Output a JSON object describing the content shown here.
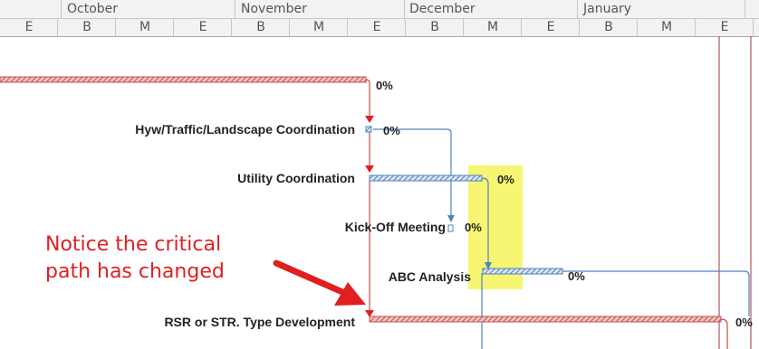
{
  "timescale": {
    "months": [
      "October",
      "November",
      "December",
      "January"
    ],
    "periods": [
      "E",
      "B",
      "M",
      "E",
      "B",
      "M",
      "E",
      "B",
      "M",
      "E",
      "B",
      "M",
      "E"
    ]
  },
  "tasks": [
    {
      "name": "",
      "percent": "0%"
    },
    {
      "name": "Hyw/Traffic/Landscape Coordination",
      "percent": "0%"
    },
    {
      "name": "Utility Coordination",
      "percent": "0%"
    },
    {
      "name": "Kick-Off Meeting",
      "percent": "0%"
    },
    {
      "name": "ABC Analysis",
      "percent": "0%"
    },
    {
      "name": "RSR or STR. Type Development",
      "percent": "0%"
    }
  ],
  "annotation": {
    "line1": "Notice the critical",
    "line2": "path has changed",
    "color": "#e02020"
  },
  "colors": {
    "critical": "#c0504d",
    "normal": "#4f81bd",
    "highlight": "#f4f55a"
  }
}
